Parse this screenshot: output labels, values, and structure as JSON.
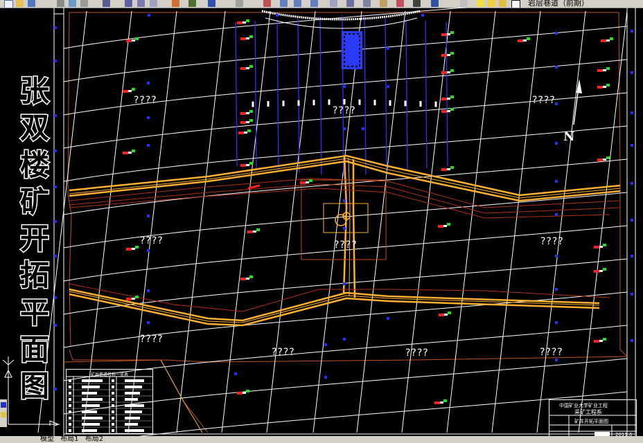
{
  "toolbar": {
    "layer_dropdown": "岩层巷道（前期）",
    "icons": [
      "new-icon",
      "open-icon",
      "save-icon",
      "print-icon",
      "preview-icon",
      "plot-icon",
      "cut-icon",
      "copy-icon",
      "paste-icon",
      "match-prop-icon",
      "undo-icon",
      "redo-icon",
      "pan-icon",
      "zoom-realtime-icon",
      "zoom-window-icon",
      "zoom-previous-icon",
      "properties-icon",
      "designcenter-icon",
      "toolpalette-icon",
      "calculator-icon",
      "help-icon",
      "layer-icon",
      "bulb-icon",
      "sun-icon",
      "lock-icon",
      "color-icon"
    ]
  },
  "drawing": {
    "vertical_title": [
      "张",
      "双",
      "楼",
      "矿",
      "开",
      "拓",
      "平",
      "面",
      "图"
    ],
    "unknown_label": "????",
    "north_label": "N",
    "legend_table_title": "矿井巷道名称一览表",
    "title_block": {
      "school": "中国矿业大学矿业工程",
      "company": "采矿工程系",
      "drawing_name": "矿井开拓平面图",
      "year": "2011.6"
    }
  },
  "tabs": {
    "model": "模型",
    "layout1": "布局1",
    "layout2": "布局2"
  },
  "colors": {
    "background": "#000000",
    "grid": "#ffffff",
    "roadway": "#ffb030",
    "boundary": "#c05020",
    "workface": "#3030ff",
    "marker_red": "#ff2020",
    "marker_green": "#20e020"
  }
}
